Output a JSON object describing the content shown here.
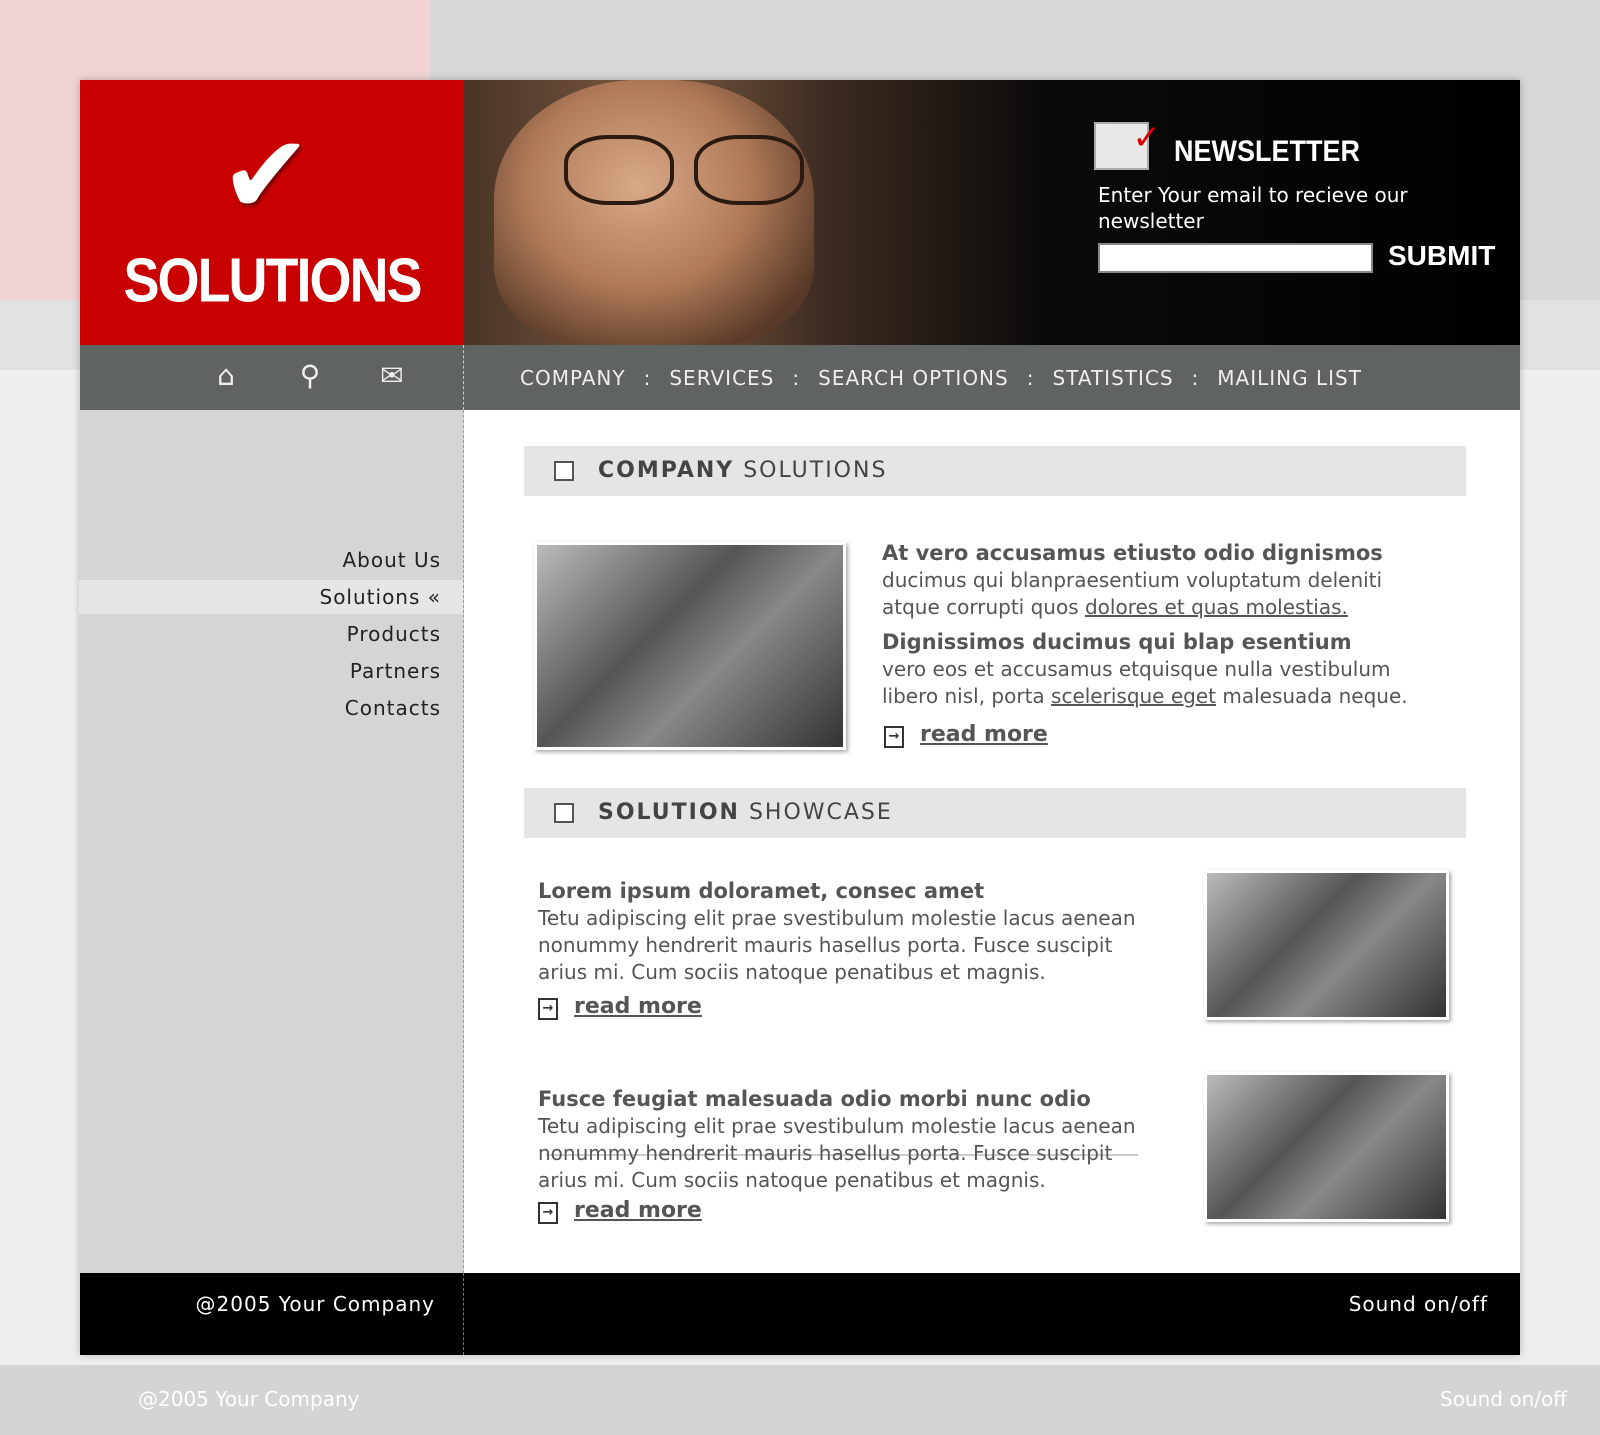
{
  "brand": {
    "name": "SOLUTIONS",
    "accent": "#c90000"
  },
  "newsletter": {
    "title": "NEWSLETTER",
    "text": "Enter Your email to recieve our newsletter",
    "input_value": "",
    "submit": "SUBMIT"
  },
  "icons": [
    "home-icon",
    "search-icon",
    "mail-icon"
  ],
  "nav": [
    "COMPANY",
    "SERVICES",
    "SEARCH OPTIONS",
    "STATISTICS",
    "MAILING LIST"
  ],
  "sidebar": {
    "items": [
      {
        "label": "About Us"
      },
      {
        "label": "Solutions «"
      },
      {
        "label": "Products"
      },
      {
        "label": "Partners"
      },
      {
        "label": "Contacts"
      }
    ],
    "active": 1
  },
  "company": {
    "title_bold": "COMPANY",
    "title_rest": " SOLUTIONS",
    "h1": "At vero accusamus etiusto odio dignismos",
    "p1": "ducimus qui blanpraesentium voluptatum deleniti atque corrupti quos ",
    "p1_link": "dolores et quas molestias.",
    "h2": "Dignissimos ducimus qui blap esentium",
    "p2": "vero eos et accusamus etquisque nulla vestibulum libero nisl, porta ",
    "p2_link": "scelerisque eget",
    "p2_end": " malesuada  neque.",
    "read_more": "read more"
  },
  "showcase": {
    "title_bold": "SOLUTION",
    "title_rest": " SHOWCASE",
    "items": [
      {
        "title": "Lorem ipsum doloramet, consec amet",
        "text": "Tetu adipiscing elit prae svestibulum molestie lacus aenean nonummy hendrerit mauris hasellus porta. Fusce suscipit arius mi. Cum sociis natoque penatibus et magnis.",
        "read_more": "read more"
      },
      {
        "title": "Fusce feugiat malesuada odio morbi nunc odio",
        "text": "Tetu adipiscing elit prae svestibulum molestie lacus aenean nonummy hendrerit mauris hasellus porta. Fusce suscipit arius mi. Cum sociis natoque penatibus et magnis.",
        "read_more": "read more"
      }
    ]
  },
  "footer": {
    "copyright": "@2005 Your Company",
    "sound": "Sound on/off"
  }
}
